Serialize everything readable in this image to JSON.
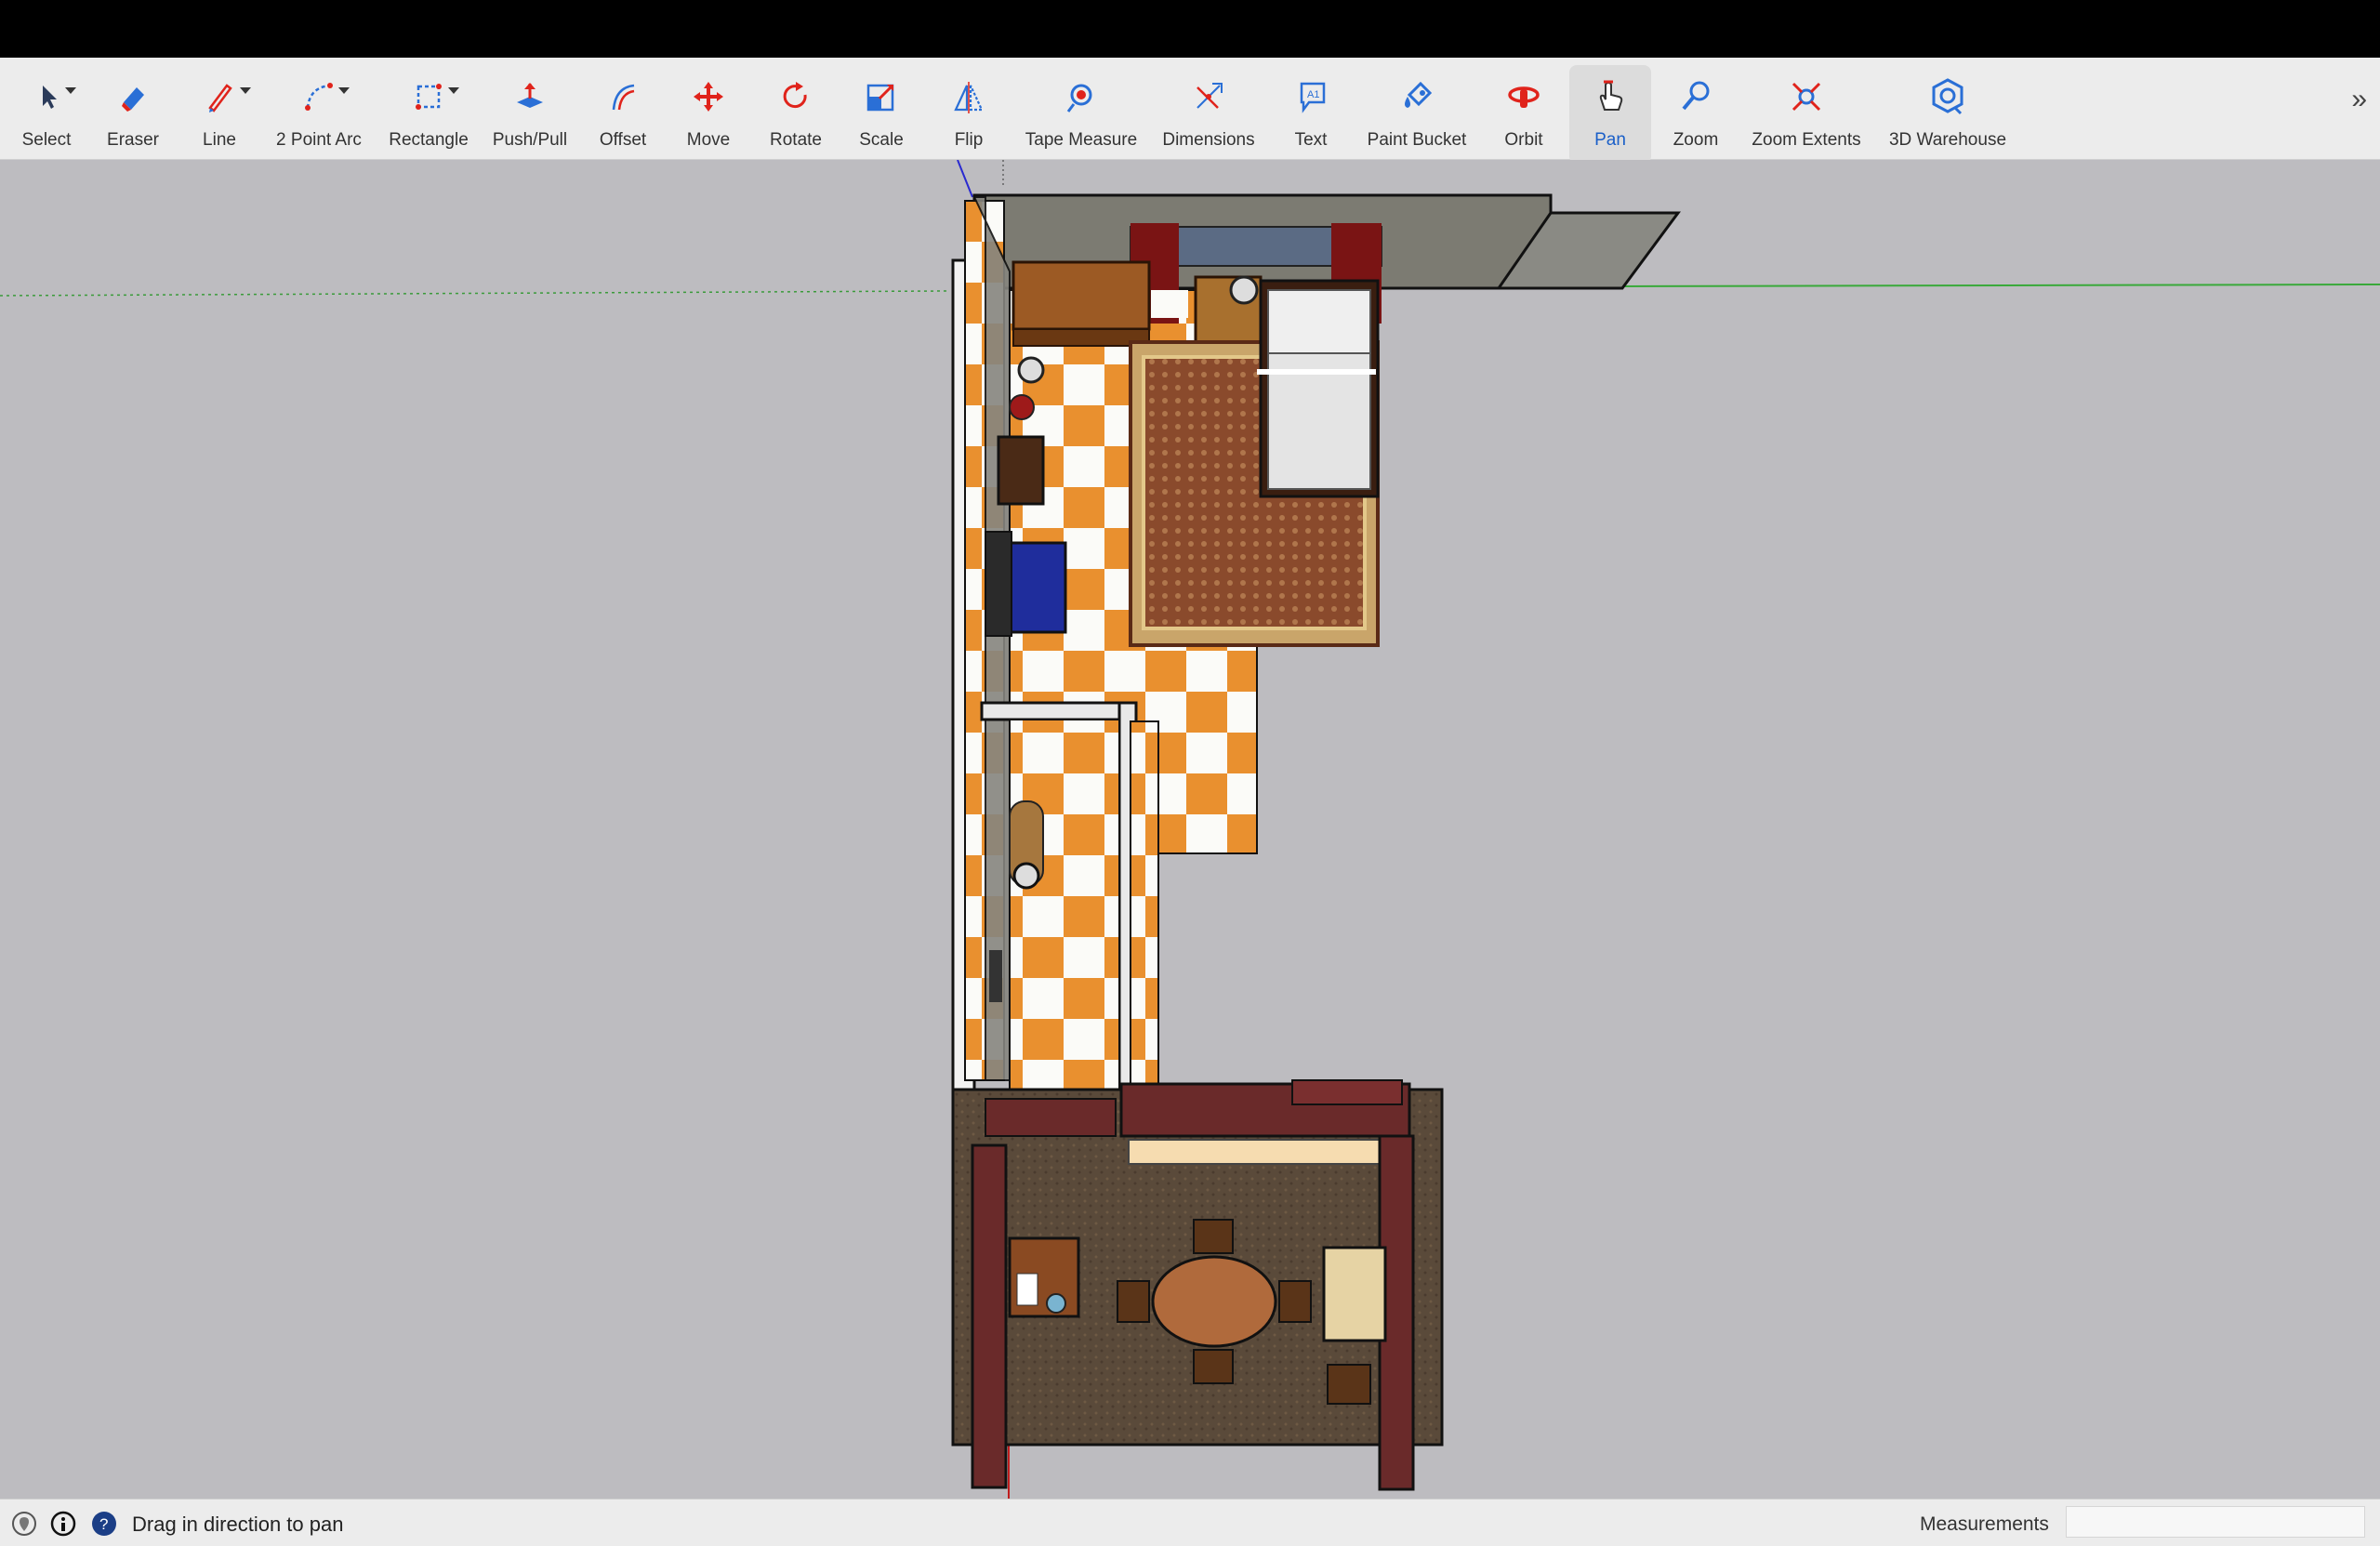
{
  "toolbar": {
    "tools": [
      {
        "name": "Select",
        "icon": "select-arrow-icon"
      },
      {
        "name": "Eraser",
        "icon": "eraser-icon"
      },
      {
        "name": "Line",
        "icon": "pencil-icon"
      },
      {
        "name": "2 Point Arc",
        "icon": "arc-icon"
      },
      {
        "name": "Rectangle",
        "icon": "rectangle-icon"
      },
      {
        "name": "Push/Pull",
        "icon": "push-pull-icon"
      },
      {
        "name": "Offset",
        "icon": "offset-icon"
      },
      {
        "name": "Move",
        "icon": "move-icon"
      },
      {
        "name": "Rotate",
        "icon": "rotate-icon"
      },
      {
        "name": "Scale",
        "icon": "scale-icon"
      },
      {
        "name": "Flip",
        "icon": "flip-icon"
      },
      {
        "name": "Tape Measure",
        "icon": "tape-measure-icon"
      },
      {
        "name": "Dimensions",
        "icon": "dimensions-icon"
      },
      {
        "name": "Text",
        "icon": "text-icon"
      },
      {
        "name": "Paint Bucket",
        "icon": "paint-bucket-icon"
      },
      {
        "name": "Orbit",
        "icon": "orbit-icon"
      },
      {
        "name": "Pan",
        "icon": "pan-hand-icon"
      },
      {
        "name": "Zoom",
        "icon": "zoom-icon"
      },
      {
        "name": "Zoom Extents",
        "icon": "zoom-extents-icon"
      },
      {
        "name": "3D Warehouse",
        "icon": "warehouse-icon"
      }
    ],
    "active_tool": "Pan",
    "more_symbol": "»"
  },
  "statusbar": {
    "hint": "Drag in direction to pan",
    "measurements_label": "Measurements",
    "measurements_value": ""
  },
  "colors": {
    "accent": "#1a5fc8",
    "toolbar_bg": "#ececec",
    "viewport_bg": "#bdbcc0",
    "tool_red": "#e0231b",
    "tool_blue": "#2a6fd6"
  }
}
